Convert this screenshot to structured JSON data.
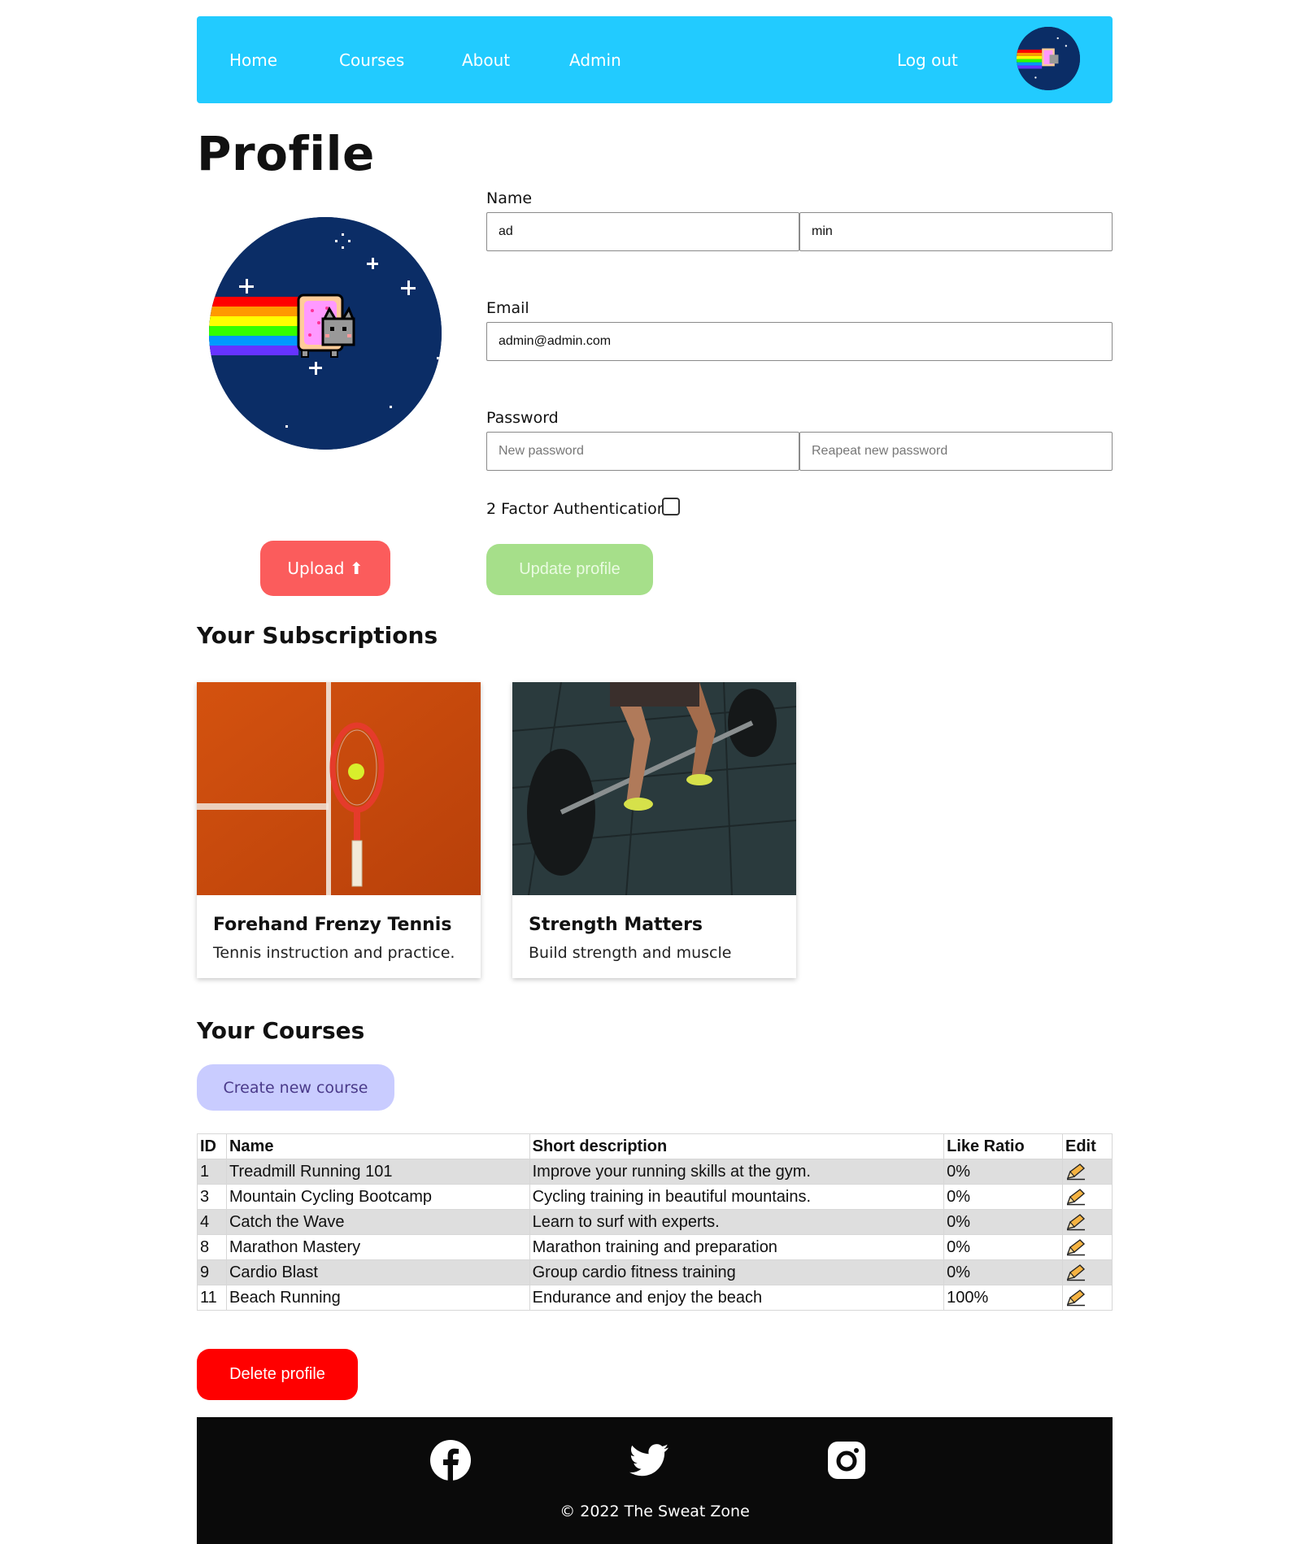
{
  "nav": {
    "items": [
      {
        "label": "Home"
      },
      {
        "label": "Courses"
      },
      {
        "label": "About"
      },
      {
        "label": "Admin"
      }
    ],
    "logout_label": "Log out"
  },
  "page_title": "Profile",
  "form": {
    "name_label": "Name",
    "first_name": "ad",
    "last_name": "min",
    "email_label": "Email",
    "email": "admin@admin.com",
    "password_label": "Password",
    "new_password_placeholder": "New password",
    "repeat_password_placeholder": "Reapeat new password",
    "two_factor_label": "2 Factor Authentication",
    "two_factor_checked": false,
    "upload_label": "Upload ⬆",
    "update_label": "Update profile"
  },
  "subscriptions": {
    "heading": "Your Subscriptions",
    "cards": [
      {
        "title": "Forehand Frenzy Tennis",
        "description": "Tennis instruction and practice."
      },
      {
        "title": "Strength Matters",
        "description": "Build strength and muscle"
      }
    ]
  },
  "courses": {
    "heading": "Your Courses",
    "create_label": "Create new course",
    "columns": [
      "ID",
      "Name",
      "Short description",
      "Like Ratio",
      "Edit"
    ],
    "rows": [
      {
        "id": "1",
        "name": "Treadmill Running 101",
        "desc": "Improve your running skills at the gym.",
        "ratio": "0%"
      },
      {
        "id": "3",
        "name": "Mountain Cycling Bootcamp",
        "desc": "Cycling training in beautiful mountains.",
        "ratio": "0%"
      },
      {
        "id": "4",
        "name": "Catch the Wave",
        "desc": "Learn to surf with experts.",
        "ratio": "0%"
      },
      {
        "id": "8",
        "name": "Marathon Mastery",
        "desc": "Marathon training and preparation",
        "ratio": "0%"
      },
      {
        "id": "9",
        "name": "Cardio Blast",
        "desc": "Group cardio fitness training",
        "ratio": "0%"
      },
      {
        "id": "11",
        "name": "Beach Running",
        "desc": "Endurance and enjoy the beach",
        "ratio": "100%"
      }
    ]
  },
  "delete_label": "Delete profile",
  "footer": {
    "copyright": "© 2022 The Sweat Zone",
    "icons": [
      "facebook-icon",
      "twitter-icon",
      "instagram-icon"
    ]
  },
  "colors": {
    "navbar": "#22cbff",
    "upload": "#fb5c5c",
    "update": "#a6df8a",
    "create": "#c9ccff",
    "delete": "#ff0000",
    "footer": "#0a0a0a"
  }
}
